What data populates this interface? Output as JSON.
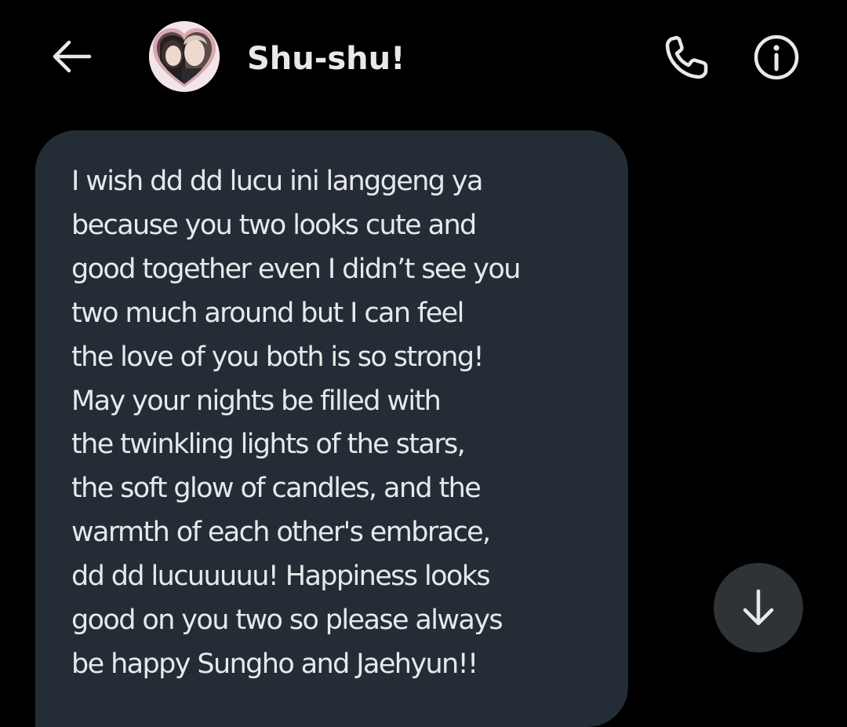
{
  "header": {
    "back_icon": "arrow-left-icon",
    "contact_name": "Shu-shu!",
    "avatar": "profile-avatar",
    "call_icon": "phone-icon",
    "info_icon": "info-icon"
  },
  "message": {
    "lines": [
      "I wish dd dd lucu ini langgeng ya",
      "because you two looks cute and",
      "good together even I didn’t see you",
      "two much around but I can feel",
      "the love of you both is so strong!",
      "May your nights be filled with",
      "the twinkling lights of the stars,",
      "the soft glow of candles, and the",
      "warmth of each other's embrace,",
      "dd dd lucuuuuu! Happiness looks",
      "good on you two so please always",
      "be happy Sungho and Jaehyun!!"
    ]
  },
  "scroll_button": {
    "icon": "arrow-down-icon"
  },
  "colors": {
    "background": "#000000",
    "bubble": "#242d35",
    "text": "#e7e9ea",
    "scroll_button": "#2f3336"
  }
}
